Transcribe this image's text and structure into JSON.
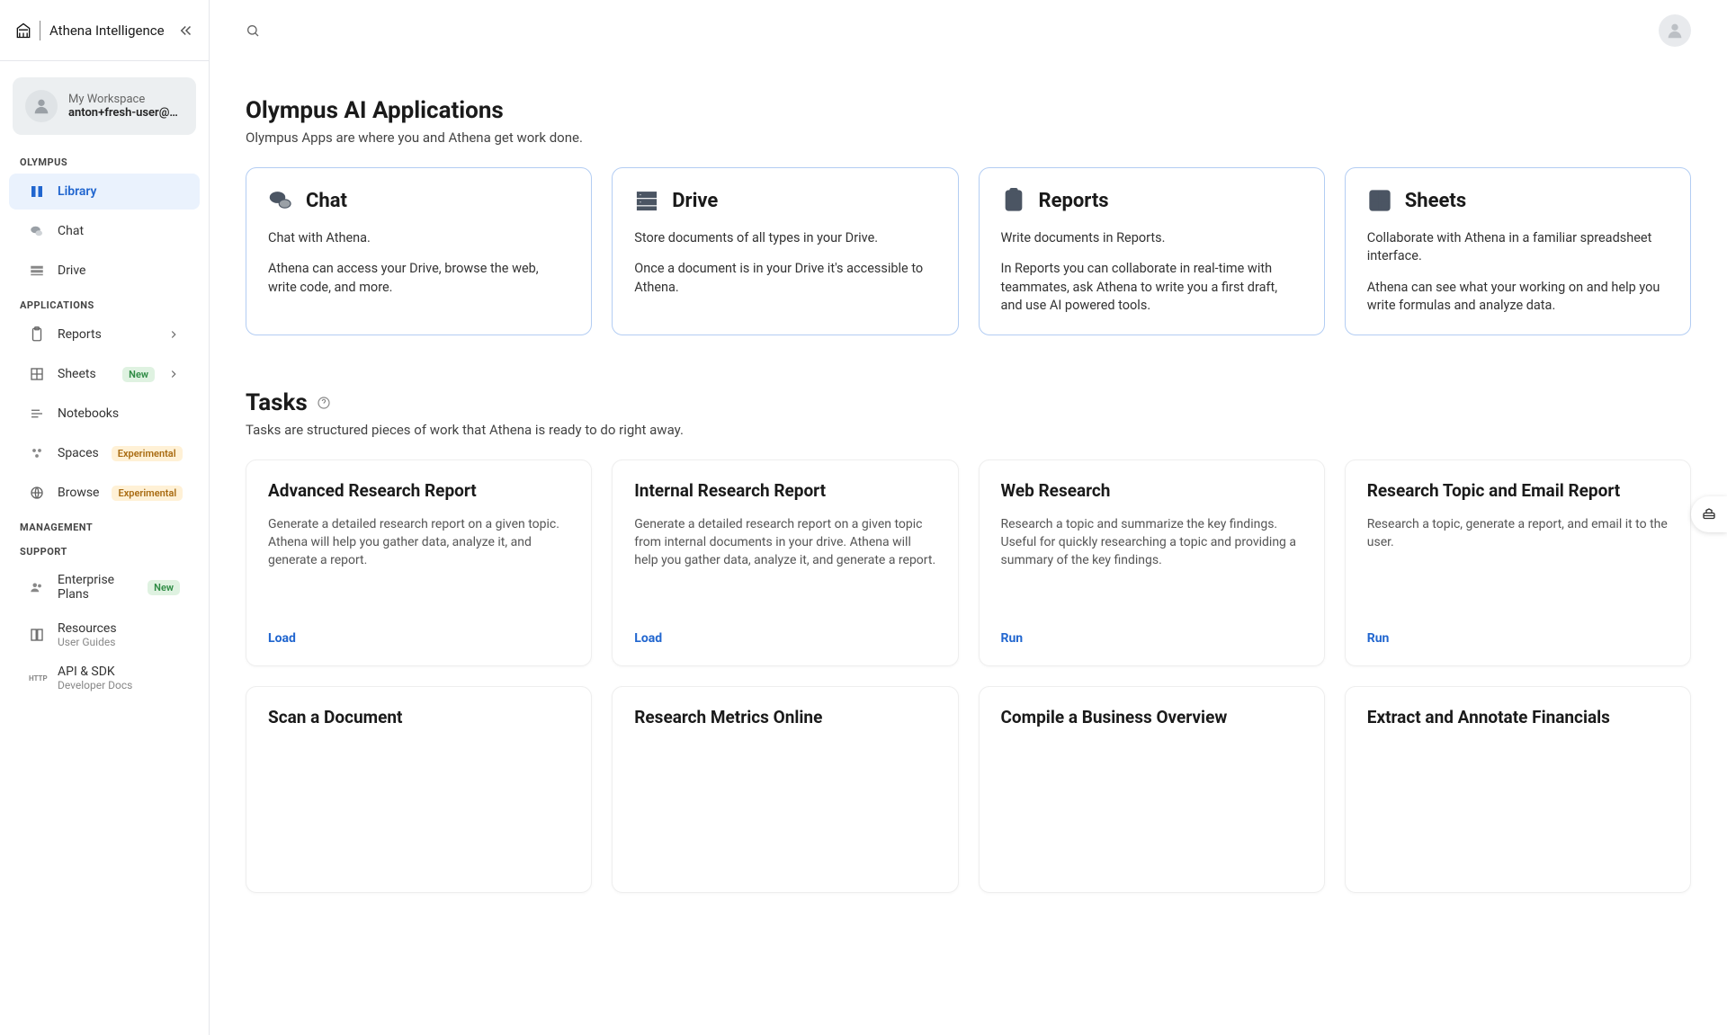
{
  "brand": {
    "name": "Athena Intelligence"
  },
  "workspace": {
    "label": "My Workspace",
    "user": "anton+fresh-user@…"
  },
  "sections": {
    "olympus": "OLYMPUS",
    "applications": "APPLICATIONS",
    "management": "MANAGEMENT",
    "support": "SUPPORT"
  },
  "nav": {
    "library": "Library",
    "chat": "Chat",
    "drive": "Drive",
    "reports": "Reports",
    "sheets": "Sheets",
    "notebooks": "Notebooks",
    "spaces": "Spaces",
    "browse": "Browse",
    "enterprise": "Enterprise Plans",
    "resources": {
      "title": "Resources",
      "sub": "User Guides"
    },
    "api": {
      "title": "API & SDK",
      "sub": "Developer Docs"
    }
  },
  "badges": {
    "new": "New",
    "experimental": "Experimental"
  },
  "page": {
    "appsTitle": "Olympus AI Applications",
    "appsSubtitle": "Olympus Apps are where you and Athena get work done.",
    "tasksTitle": "Tasks",
    "tasksSubtitle": "Tasks are structured pieces of work that Athena is ready to do right away."
  },
  "apps": [
    {
      "title": "Chat",
      "desc1": "Chat with Athena.",
      "desc2": "Athena can access your Drive, browse the web, write code, and more."
    },
    {
      "title": "Drive",
      "desc1": "Store documents of all types in your Drive.",
      "desc2": "Once a document is in your Drive it's accessible to Athena."
    },
    {
      "title": "Reports",
      "desc1": "Write documents in Reports.",
      "desc2": "In Reports you can collaborate in real-time with teammates, ask Athena to write you a first draft, and use AI powered tools."
    },
    {
      "title": "Sheets",
      "desc1": "Collaborate with Athena in a familiar spreadsheet interface.",
      "desc2": "Athena can see what your working on and help you write formulas and analyze data."
    }
  ],
  "tasks": [
    {
      "title": "Advanced Research Report",
      "desc": "Generate a detailed research report on a given topic. Athena will help you gather data, analyze it, and generate a report.",
      "action": "Load"
    },
    {
      "title": "Internal Research Report",
      "desc": "Generate a detailed research report on a given topic from internal documents in your drive. Athena will help you gather data, analyze it, and generate a report.",
      "action": "Load"
    },
    {
      "title": "Web Research",
      "desc": "Research a topic and summarize the key findings. Useful for quickly researching a topic and providing a summary of the key findings.",
      "action": "Run"
    },
    {
      "title": "Research Topic and Email Report",
      "desc": "Research a topic, generate a report, and email it to the user.",
      "action": "Run"
    },
    {
      "title": "Scan a Document",
      "desc": "",
      "action": ""
    },
    {
      "title": "Research Metrics Online",
      "desc": "",
      "action": ""
    },
    {
      "title": "Compile a Business Overview",
      "desc": "",
      "action": ""
    },
    {
      "title": "Extract and Annotate Financials",
      "desc": "",
      "action": ""
    }
  ]
}
